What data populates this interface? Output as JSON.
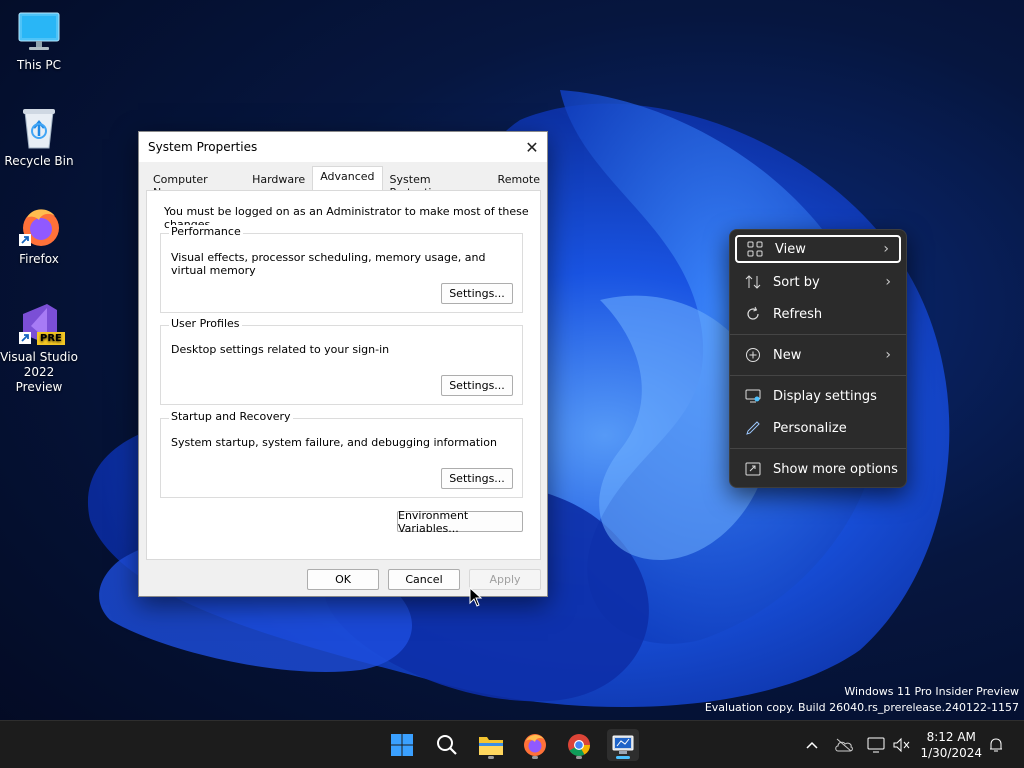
{
  "desktop": {
    "icons": [
      {
        "label": "This PC",
        "icon": "monitor-icon"
      },
      {
        "label": "Recycle Bin",
        "icon": "recycle-bin-icon"
      },
      {
        "label": "Firefox",
        "icon": "firefox-icon"
      },
      {
        "label_line1": "Visual Studio",
        "label_line2": "2022 Preview",
        "icon": "visual-studio-preview-icon",
        "badge": "PRE"
      }
    ]
  },
  "dialog": {
    "title": "System Properties",
    "close_glyph": "✕",
    "tabs": [
      "Computer Name",
      "Hardware",
      "Advanced",
      "System Protection",
      "Remote"
    ],
    "active_tab": "Advanced",
    "admin_note": "You must be logged on as an Administrator to make most of these changes.",
    "groups": [
      {
        "label": "Performance",
        "desc": "Visual effects, processor scheduling, memory usage, and virtual memory",
        "button": "Settings..."
      },
      {
        "label": "User Profiles",
        "desc": "Desktop settings related to your sign-in",
        "button": "Settings..."
      },
      {
        "label": "Startup and Recovery",
        "desc": "System startup, system failure, and debugging information",
        "button": "Settings..."
      }
    ],
    "env_button": "Environment Variables...",
    "ok": "OK",
    "cancel": "Cancel",
    "apply": "Apply"
  },
  "context_menu": {
    "items": [
      {
        "label": "View",
        "icon": "grid-icon",
        "submenu": true,
        "focused": true
      },
      {
        "label": "Sort by",
        "icon": "sort-icon",
        "submenu": true
      },
      {
        "label": "Refresh",
        "icon": "refresh-icon"
      },
      {
        "label": "New",
        "icon": "plus-circle-icon",
        "submenu": true
      },
      {
        "label": "Display settings",
        "icon": "display-settings-icon"
      },
      {
        "label": "Personalize",
        "icon": "pen-icon"
      },
      {
        "label": "Show more options",
        "icon": "show-more-options-icon"
      }
    ],
    "arrow_glyph": "›"
  },
  "watermark": {
    "line1": "Windows 11 Pro Insider Preview",
    "line2": "Evaluation copy. Build 26040.rs_prerelease.240122-1157"
  },
  "taskbar": {
    "apps": [
      "start-icon",
      "search-icon",
      "file-explorer-icon",
      "firefox-icon",
      "chrome-icon",
      "system-properties-icon"
    ],
    "active_app": "system-properties-icon",
    "tray": [
      "chevron-up-icon",
      "onedrive-icon",
      "display-icon",
      "volume-muted-icon",
      "notification-bell-icon"
    ],
    "time": "8:12 AM",
    "date": "1/30/2024"
  },
  "colors": {
    "accent": "#0067c0",
    "menu_bg": "#2b2b2b",
    "taskbar_bg": "#1c1c1c",
    "active_indicator": "#4cc2ff"
  }
}
